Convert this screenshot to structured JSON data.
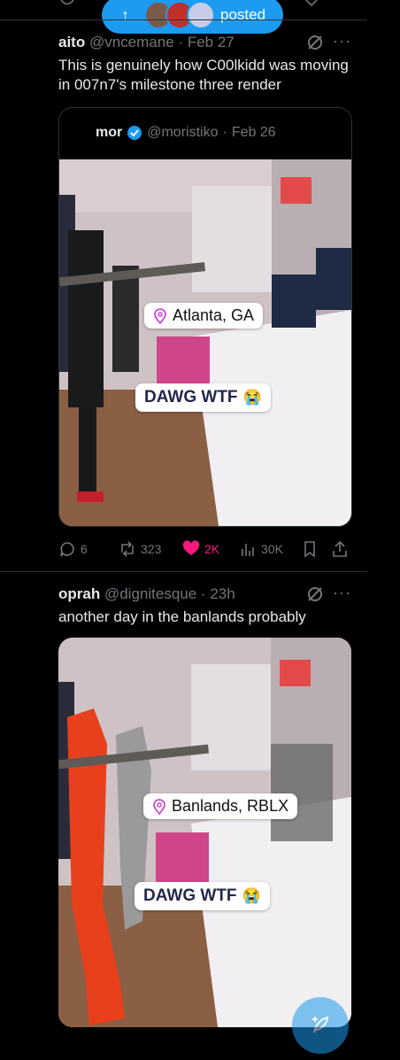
{
  "top_pill": {
    "label": "posted",
    "arrow": "↑"
  },
  "tweet1": {
    "name": "aito",
    "handle": "@vncemane",
    "date": "Feb 27",
    "text": "This is genuinely how C00lkidd was moving in 007n7's milestone three render",
    "quote": {
      "name": "mor",
      "handle": "@moristiko",
      "date": "Feb 26",
      "location_tag": "Atlanta, GA",
      "caption": "DAWG WTF",
      "emoji": "😭"
    },
    "actions": {
      "replies": "6",
      "reposts": "323",
      "likes": "2K",
      "views": "30K"
    }
  },
  "tweet2": {
    "name": "oprah",
    "handle": "@dignitesque",
    "date": "23h",
    "text": "another day in the banlands probably",
    "location_tag": "Banlands, RBLX",
    "caption": "DAWG WTF",
    "emoji": "😭"
  },
  "separator": "·",
  "colors": {
    "accent": "#1d9bf0",
    "like": "#f91880",
    "muted": "#71767b",
    "divider": "#2f3336"
  }
}
